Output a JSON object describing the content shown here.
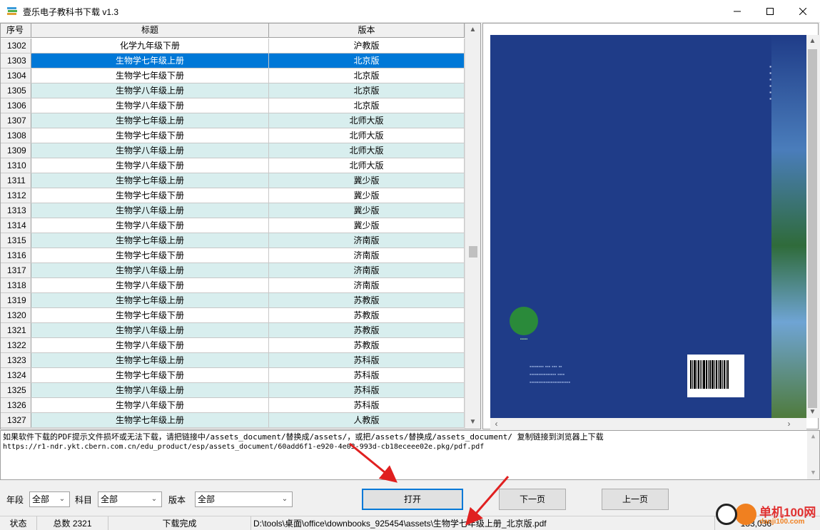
{
  "window": {
    "title": "壹乐电子教科书下载 v1.3",
    "minimize": "—",
    "maximize": "☐",
    "close": "✕"
  },
  "grid": {
    "headers": [
      "序号",
      "标题",
      "版本"
    ],
    "rows": [
      {
        "no": "1302",
        "title": "化学九年级下册",
        "edition": "沪教版",
        "style": "plain"
      },
      {
        "no": "1303",
        "title": "生物学七年级上册",
        "edition": "北京版",
        "style": "selected"
      },
      {
        "no": "1304",
        "title": "生物学七年级下册",
        "edition": "北京版",
        "style": "plain"
      },
      {
        "no": "1305",
        "title": "生物学八年级上册",
        "edition": "北京版",
        "style": "alt"
      },
      {
        "no": "1306",
        "title": "生物学八年级下册",
        "edition": "北京版",
        "style": "plain"
      },
      {
        "no": "1307",
        "title": "生物学七年级上册",
        "edition": "北师大版",
        "style": "alt"
      },
      {
        "no": "1308",
        "title": "生物学七年级下册",
        "edition": "北师大版",
        "style": "plain"
      },
      {
        "no": "1309",
        "title": "生物学八年级上册",
        "edition": "北师大版",
        "style": "alt"
      },
      {
        "no": "1310",
        "title": "生物学八年级下册",
        "edition": "北师大版",
        "style": "plain"
      },
      {
        "no": "1311",
        "title": "生物学七年级上册",
        "edition": "冀少版",
        "style": "alt"
      },
      {
        "no": "1312",
        "title": "生物学七年级下册",
        "edition": "冀少版",
        "style": "plain"
      },
      {
        "no": "1313",
        "title": "生物学八年级上册",
        "edition": "冀少版",
        "style": "alt"
      },
      {
        "no": "1314",
        "title": "生物学八年级下册",
        "edition": "冀少版",
        "style": "plain"
      },
      {
        "no": "1315",
        "title": "生物学七年级上册",
        "edition": "济南版",
        "style": "alt"
      },
      {
        "no": "1316",
        "title": "生物学七年级下册",
        "edition": "济南版",
        "style": "plain"
      },
      {
        "no": "1317",
        "title": "生物学八年级上册",
        "edition": "济南版",
        "style": "alt"
      },
      {
        "no": "1318",
        "title": "生物学八年级下册",
        "edition": "济南版",
        "style": "plain"
      },
      {
        "no": "1319",
        "title": "生物学七年级上册",
        "edition": "苏教版",
        "style": "alt"
      },
      {
        "no": "1320",
        "title": "生物学七年级下册",
        "edition": "苏教版",
        "style": "plain"
      },
      {
        "no": "1321",
        "title": "生物学八年级上册",
        "edition": "苏教版",
        "style": "alt"
      },
      {
        "no": "1322",
        "title": "生物学八年级下册",
        "edition": "苏教版",
        "style": "plain"
      },
      {
        "no": "1323",
        "title": "生物学七年级上册",
        "edition": "苏科版",
        "style": "alt"
      },
      {
        "no": "1324",
        "title": "生物学七年级下册",
        "edition": "苏科版",
        "style": "plain"
      },
      {
        "no": "1325",
        "title": "生物学八年级上册",
        "edition": "苏科版",
        "style": "alt"
      },
      {
        "no": "1326",
        "title": "生物学八年级下册",
        "edition": "苏科版",
        "style": "plain"
      },
      {
        "no": "1327",
        "title": "生物学七年级上册",
        "edition": "人教版",
        "style": "alt"
      }
    ]
  },
  "message": {
    "line1": "如果软件下载的PDF提示文件损坏或无法下载，请把链接中/assets_document/替换成/assets/，或把/assets/替换成/assets_document/  复制链接到浏览器上下载",
    "line2": "https://r1-ndr.ykt.cbern.com.cn/edu_product/esp/assets_document/60add6f1-e920-4e03-993d-cb18eceee02e.pkg/pdf.pdf"
  },
  "filters": {
    "grade_label": "年段",
    "grade_value": "全部",
    "subject_label": "科目",
    "subject_value": "全部",
    "edition_label": "版本",
    "edition_value": "全部"
  },
  "buttons": {
    "open": "打开",
    "next_page": "下一页",
    "prev_page": "上一页"
  },
  "status": {
    "label": "状态",
    "total": "总数 2321",
    "state": "下载完成",
    "path": "D:\\tools\\桌面\\office\\downbooks_925454\\assets\\生物学七年级上册_北京版.pdf",
    "size": "183,036"
  },
  "watermark": {
    "text": "单机100网",
    "sub": "danji100.com"
  },
  "colors": {
    "selection": "#0078d7",
    "alt_row": "#d8eeee",
    "annotation_arrow": "#e02020"
  }
}
